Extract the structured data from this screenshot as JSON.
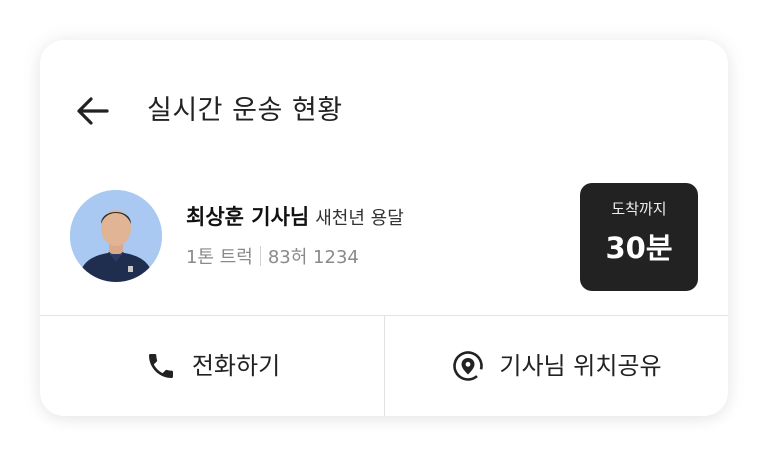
{
  "header": {
    "back_icon": "arrow-left-icon",
    "title": "실시간 운송 현황"
  },
  "driver": {
    "name": "최상훈 기사님",
    "company": "새천년 용달",
    "vehicle_type": "1톤 트럭",
    "plate": "83허 1234",
    "avatar_icon": "driver-photo"
  },
  "eta": {
    "label": "도착까지",
    "value": "30분"
  },
  "actions": {
    "call_label": "전화하기",
    "call_icon": "phone-icon",
    "share_label": "기사님 위치공유",
    "share_icon": "location-share-icon"
  },
  "colors": {
    "eta_background": "#222222",
    "avatar_background": "#a9c8f2",
    "divider": "#e2e2e2",
    "muted_text": "#8a8a8a"
  }
}
